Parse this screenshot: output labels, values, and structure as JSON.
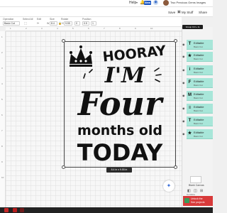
{
  "topbar": {
    "help": "Help",
    "new_badge": "New",
    "user_name": "Two Precious Gems Images",
    "icons": [
      "chevron-down-icon",
      "bell-icon",
      "globe-icon",
      "avatar"
    ]
  },
  "actionbar": {
    "save": "Save",
    "my_stuff": "My Stuff",
    "share": "Share"
  },
  "options": {
    "operation_label": "Operation",
    "operation_value": "Basic Cut",
    "select_label": "Select All",
    "edit_label": "Edit",
    "size_label": "Size",
    "w_label": "W",
    "w_value": "8.4",
    "h_label": "H",
    "h_value": "9.55",
    "rotate_label": "Rotate",
    "rotate_value": "0",
    "position_label": "Position",
    "x_value": "0.5",
    "y_value": "1"
  },
  "ruler": {
    "h_numbers": [
      "1",
      "2",
      "3",
      "4",
      "5",
      "6",
      "7",
      "8",
      "9",
      "10"
    ],
    "v_numbers": [
      "1",
      "2",
      "3",
      "4",
      "5",
      "6",
      "7",
      "8",
      "9",
      "10"
    ]
  },
  "design": {
    "line1": "HOORAY",
    "line2": "I'M",
    "line3": "Four",
    "line4": "months old",
    "line5": "TODAY",
    "size_label": "8.4 in x 9.55 in"
  },
  "panel": {
    "group_tooltip": "Group Ctrl + G",
    "layers": [
      {
        "name": "Editable",
        "sub": "Basic Cut",
        "thumb": "T"
      },
      {
        "name": "Editable",
        "sub": "Basic Cut",
        "thumb": "★"
      },
      {
        "name": "Editable",
        "sub": "Basic Cut",
        "thumb": "i"
      },
      {
        "name": "Editable",
        "sub": "Basic Cut",
        "thumb": "F"
      },
      {
        "name": "Editable",
        "sub": "Basic Cut",
        "thumb": "M"
      },
      {
        "name": "Editable",
        "sub": "Basic Cut",
        "thumb": "≡"
      },
      {
        "name": "Editable",
        "sub": "Basic Cut",
        "thumb": "T"
      },
      {
        "name": "Editable",
        "sub": "Basic Cut",
        "thumb": "★"
      }
    ],
    "blank_canvas": "Blank Canvas",
    "combine_label": "Combine",
    "unlock_title": "Unlock the",
    "unlock_sub": "See projects"
  },
  "colors": {
    "accent": "#1a56c4",
    "layer_bg": "#a8e6d9",
    "unlock_bg": "#d83a3a",
    "text_black": "#111111"
  }
}
